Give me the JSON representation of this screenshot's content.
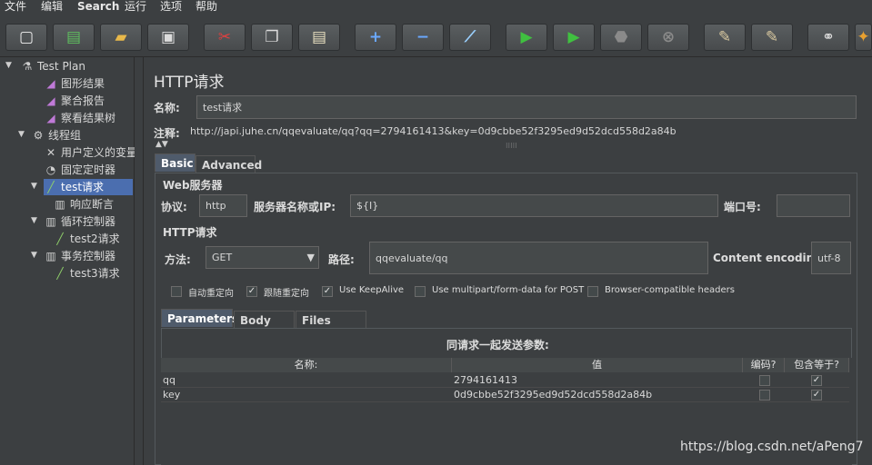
{
  "menu": [
    "文件",
    "编辑",
    "Search",
    "运行",
    "选项",
    "帮助"
  ],
  "toolbar": [
    {
      "icon": "new-icon",
      "glyph": "▢",
      "color": "#f0f0f0"
    },
    {
      "icon": "templates-icon",
      "glyph": "▤",
      "color": "#5fbf5f"
    },
    {
      "icon": "open-icon",
      "glyph": "▰",
      "color": "#e8b84a"
    },
    {
      "icon": "save-icon",
      "glyph": "▣",
      "color": "#dcdcdc"
    },
    {
      "icon": "cut-icon",
      "glyph": "✂",
      "color": "#e04040"
    },
    {
      "icon": "copy-icon",
      "glyph": "❐",
      "color": "#dcdcdc"
    },
    {
      "icon": "paste-icon",
      "glyph": "▤",
      "color": "#e8e0c0"
    },
    {
      "icon": "expand-icon",
      "glyph": "+",
      "color": "#6aa8ff"
    },
    {
      "icon": "collapse-icon",
      "glyph": "−",
      "color": "#6aa8ff"
    },
    {
      "icon": "toggle-icon",
      "glyph": "⟋",
      "color": "#9ad0ff"
    },
    {
      "icon": "start-icon",
      "glyph": "▶",
      "color": "#40c040"
    },
    {
      "icon": "start-no-pause-icon",
      "glyph": "▶",
      "color": "#40c040"
    },
    {
      "icon": "stop-icon",
      "glyph": "⬣",
      "color": "#8a8a8a"
    },
    {
      "icon": "shutdown-icon",
      "glyph": "⊗",
      "color": "#8a8a8a"
    },
    {
      "icon": "clear-icon",
      "glyph": "✎",
      "color": "#d8c8a0"
    },
    {
      "icon": "clear-all-icon",
      "glyph": "✎",
      "color": "#d8c8a0"
    },
    {
      "icon": "search-icon",
      "glyph": "⚭",
      "color": "#dcdcdc"
    },
    {
      "icon": "reset-search-icon",
      "glyph": "✦",
      "color": "#e8a030"
    }
  ],
  "tree": [
    {
      "label": "Test Plan",
      "icon": "test-plan-icon",
      "glyph": "⚗",
      "toggle": "▼",
      "level": 0
    },
    {
      "label": "图形结果",
      "icon": "graph-icon",
      "glyph": "◢",
      "toggle": "",
      "level": 2
    },
    {
      "label": "聚合报告",
      "icon": "graph-icon",
      "glyph": "◢",
      "toggle": "",
      "level": 2
    },
    {
      "label": "察看结果树",
      "icon": "graph-icon",
      "glyph": "◢",
      "toggle": "",
      "level": 2
    },
    {
      "label": "线程组",
      "icon": "thread-group-icon",
      "glyph": "⚙",
      "toggle": "▼",
      "level": 1
    },
    {
      "label": "用户定义的变量",
      "icon": "config-icon",
      "glyph": "✕",
      "toggle": "",
      "level": 3
    },
    {
      "label": "固定定时器",
      "icon": "timer-icon",
      "glyph": "◔",
      "toggle": "",
      "level": 3
    },
    {
      "label": "test请求",
      "icon": "sampler-icon",
      "glyph": "╱",
      "toggle": "▼",
      "level": 2,
      "selected": true
    },
    {
      "label": "响应断言",
      "icon": "assertion-icon",
      "glyph": "▥",
      "toggle": "",
      "level": 4
    },
    {
      "label": "循环控制器",
      "icon": "controller-icon",
      "glyph": "▥",
      "toggle": "▼",
      "level": 2
    },
    {
      "label": "test2请求",
      "icon": "sampler-icon",
      "glyph": "╱",
      "toggle": "",
      "level": 4
    },
    {
      "label": "事务控制器",
      "icon": "controller-icon",
      "glyph": "▥",
      "toggle": "▼",
      "level": 2
    },
    {
      "label": "test3请求",
      "icon": "sampler-icon",
      "glyph": "╱",
      "toggle": "",
      "level": 4
    }
  ],
  "panel": {
    "title": "HTTP请求",
    "name_label": "名称:",
    "name_value": "test请求",
    "comment_label": "注释:",
    "comment_value": "http://japi.juhe.cn/qqevaluate/qq?qq=2794161413&key=0d9cbbe52f3295ed9d52dcd558d2a84b",
    "tabs": [
      "Basic",
      "Advanced"
    ],
    "web_server_title": "Web服务器",
    "protocol_label": "协议:",
    "protocol_value": "http",
    "server_label": "服务器名称或IP:",
    "server_value": "${I}",
    "port_label": "端口号:",
    "port_value": "",
    "http_request_title": "HTTP请求",
    "method_label": "方法:",
    "method_value": "GET",
    "path_label": "路径:",
    "path_value": "qqevaluate/qq",
    "encoding_label": "Content encoding:",
    "encoding_value": "utf-8",
    "options": [
      {
        "label": "自动重定向",
        "checked": false
      },
      {
        "label": "跟随重定向",
        "checked": true
      },
      {
        "label": "Use KeepAlive",
        "checked": true
      },
      {
        "label": "Use multipart/form-data for POST",
        "checked": false
      },
      {
        "label": "Browser-compatible headers",
        "checked": false
      }
    ],
    "subtabs": [
      "Parameters",
      "Body Data",
      "Files Upload"
    ],
    "params_title": "同请求一起发送参数:",
    "columns": [
      "名称:",
      "值",
      "编码?",
      "包含等于?"
    ],
    "rows": [
      {
        "name": "qq",
        "value": "2794161413",
        "encode": false,
        "include_equals": true
      },
      {
        "name": "key",
        "value": "0d9cbbe52f3295ed9d52dcd558d2a84b",
        "encode": false,
        "include_equals": true
      }
    ]
  },
  "watermark": "https://blog.csdn.net/aPeng7"
}
